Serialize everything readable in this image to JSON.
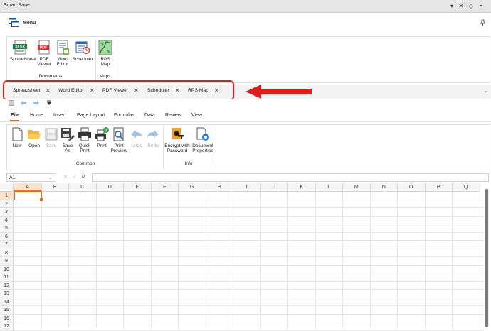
{
  "window": {
    "title": "Smart Pane",
    "controls": [
      "▾",
      "✕",
      "◇",
      "✕"
    ]
  },
  "menu": {
    "label": "Menu"
  },
  "top_ribbon": {
    "items": [
      {
        "label": "Spreadsheet",
        "icon": "spreadsheet-xlsx-icon"
      },
      {
        "label": "PDF\nViewer",
        "icon": "pdf-icon"
      },
      {
        "label": "Word\nEditor",
        "icon": "word-document-icon"
      },
      {
        "label": "Scheduler",
        "icon": "scheduler-calendar-icon"
      },
      {
        "label": "RPS\nMap",
        "icon": "map-icon"
      }
    ],
    "groups": [
      "Documents",
      "Maps"
    ]
  },
  "doc_tabs": [
    "Spreadsheet",
    "Word Editor",
    "PDF Viewer",
    "Scheduler",
    "RPS Map"
  ],
  "ribbon_tabs": [
    "File",
    "Home",
    "Insert",
    "Page Layout",
    "Formulas",
    "Data",
    "Review",
    "View"
  ],
  "active_ribbon_tab": "File",
  "file_ribbon": {
    "items": [
      {
        "label": "New",
        "icon": "new-document-icon",
        "enabled": true
      },
      {
        "label": "Open",
        "icon": "folder-open-icon",
        "enabled": true
      },
      {
        "label": "Save",
        "icon": "save-icon",
        "enabled": false
      },
      {
        "label": "Save\nAs",
        "icon": "save-as-icon",
        "enabled": true
      },
      {
        "label": "Quick\nPrint",
        "icon": "quick-print-icon",
        "enabled": true
      },
      {
        "label": "Print",
        "icon": "print-icon",
        "enabled": true
      },
      {
        "label": "Print\nPreview",
        "icon": "print-preview-icon",
        "enabled": true
      },
      {
        "label": "Undo",
        "icon": "undo-icon",
        "enabled": false
      },
      {
        "label": "Redo",
        "icon": "redo-icon",
        "enabled": false
      },
      {
        "label": "Encrypt with\nPassword",
        "icon": "encrypt-key-icon",
        "enabled": true
      },
      {
        "label": "Document\nProperties",
        "icon": "document-properties-icon",
        "enabled": true
      }
    ],
    "groups": [
      "Common",
      "Info"
    ]
  },
  "formula_bar": {
    "cell_ref": "A1",
    "cancel": "✕",
    "enter": "✓",
    "fx": "fx",
    "value": ""
  },
  "sheet": {
    "columns": [
      "A",
      "B",
      "C",
      "D",
      "E",
      "F",
      "G",
      "H",
      "I",
      "J",
      "K",
      "L",
      "M",
      "N",
      "O",
      "P",
      "Q"
    ],
    "rows": [
      "1",
      "2",
      "3",
      "4",
      "5",
      "6",
      "7",
      "8",
      "9",
      "10",
      "11",
      "12",
      "13",
      "14",
      "15",
      "16",
      "17"
    ],
    "selected_cell": "A1"
  },
  "colors": {
    "annotation": "#e01c1c",
    "accent": "#e07020",
    "selection": "#f0c8a0"
  }
}
